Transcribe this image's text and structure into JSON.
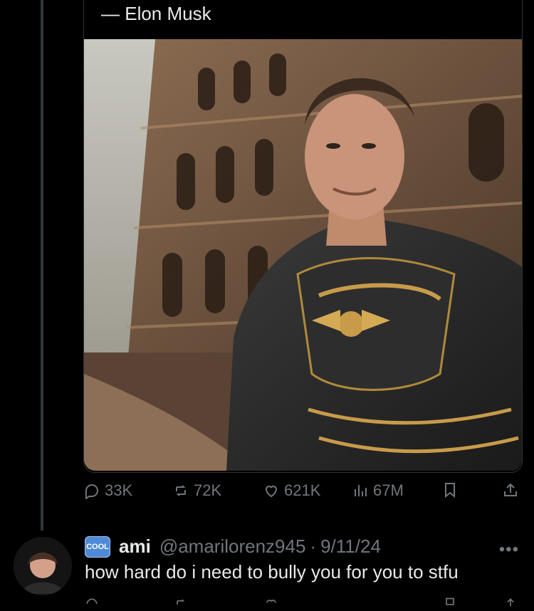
{
  "quote": {
    "attribution": "— Elon Musk"
  },
  "image": {
    "description_icon": "photo"
  },
  "actions": {
    "replies": "33K",
    "reposts": "72K",
    "likes": "621K",
    "views": "67M"
  },
  "reply": {
    "badge": "COOL",
    "name": "ami",
    "handle": "@amarilorenz945",
    "separator": "·",
    "date": "9/11/24",
    "text": "how hard do i need to bully you for you to stfu",
    "more": "•••"
  },
  "colors": {
    "muted": "#71767b",
    "text": "#e7e9ea",
    "bg": "#000000",
    "badge": "#4f8ad7"
  }
}
